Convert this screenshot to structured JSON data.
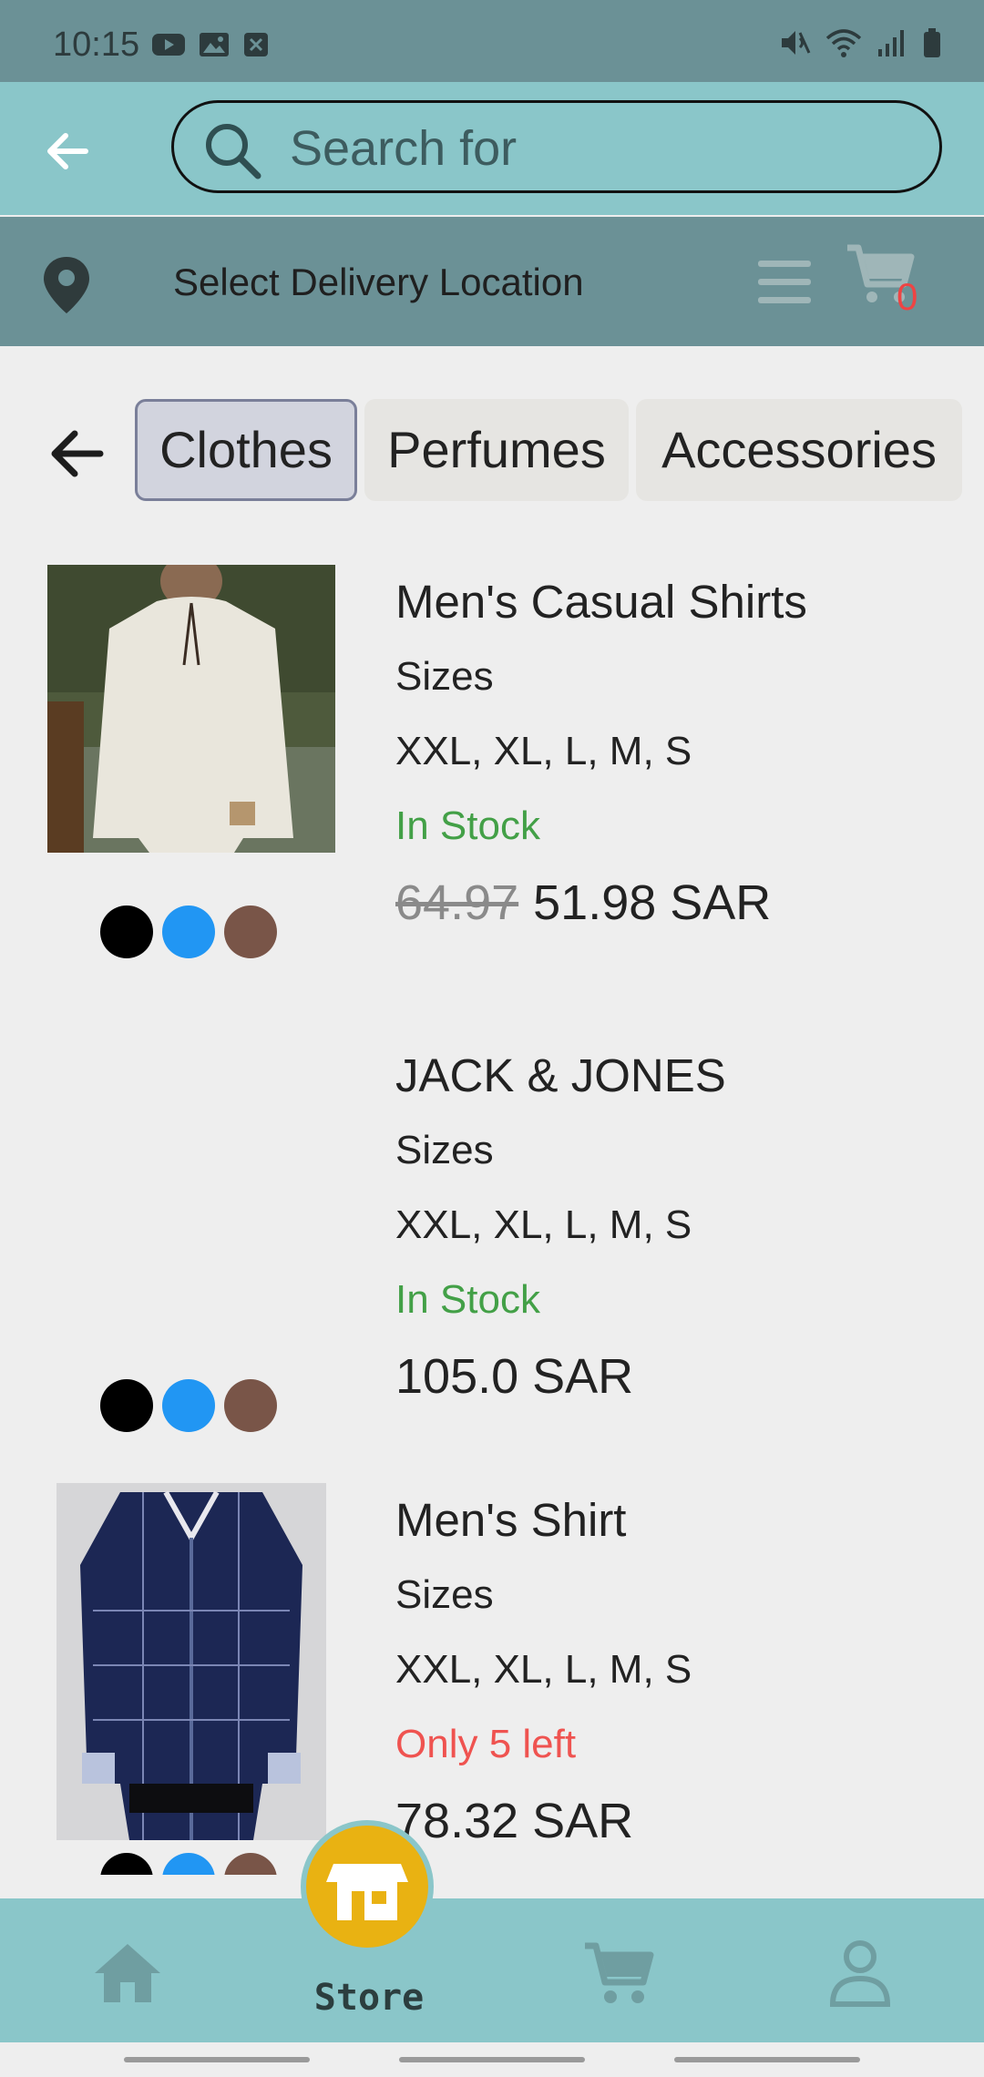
{
  "status_bar": {
    "time": "10:15"
  },
  "search": {
    "placeholder": "Search for"
  },
  "location": {
    "label": "Select Delivery Location",
    "cart_count": "0"
  },
  "categories": {
    "tabs": [
      {
        "label": "Clothes",
        "active": true
      },
      {
        "label": "Perfumes",
        "active": false
      },
      {
        "label": "Accessories",
        "active": false
      }
    ]
  },
  "products": [
    {
      "name": "Men's Casual Shirts",
      "sizes_label": "Sizes",
      "sizes": "XXL, XL, L, M, S",
      "stock": "In Stock",
      "stock_color": "#43a047",
      "old_price": "64.97",
      "price": "51.98 SAR",
      "colors": [
        "#000000",
        "#2196f3",
        "#795548"
      ]
    },
    {
      "name": "JACK & JONES",
      "sizes_label": "Sizes",
      "sizes": "XXL, XL, L, M, S",
      "stock": "In Stock",
      "stock_color": "#43a047",
      "old_price": "",
      "price": "105.0 SAR",
      "colors": [
        "#000000",
        "#2196f3",
        "#795548"
      ]
    },
    {
      "name": "Men's Shirt",
      "sizes_label": "Sizes",
      "sizes": "XXL, XL, L, M, S",
      "stock": "Only 5 left",
      "stock_color": "#ef5350",
      "old_price": "",
      "price": "78.32 SAR",
      "colors": [
        "#000000",
        "#2196f3",
        "#795548"
      ]
    }
  ],
  "bottom_nav": {
    "store_label": "Store",
    "items": [
      "home-icon",
      "store-icon",
      "cart-icon",
      "profile-icon"
    ]
  },
  "colors": {
    "header": "#8ac6c9",
    "location_bar": "#6b9196",
    "accent": "#e9b212"
  }
}
